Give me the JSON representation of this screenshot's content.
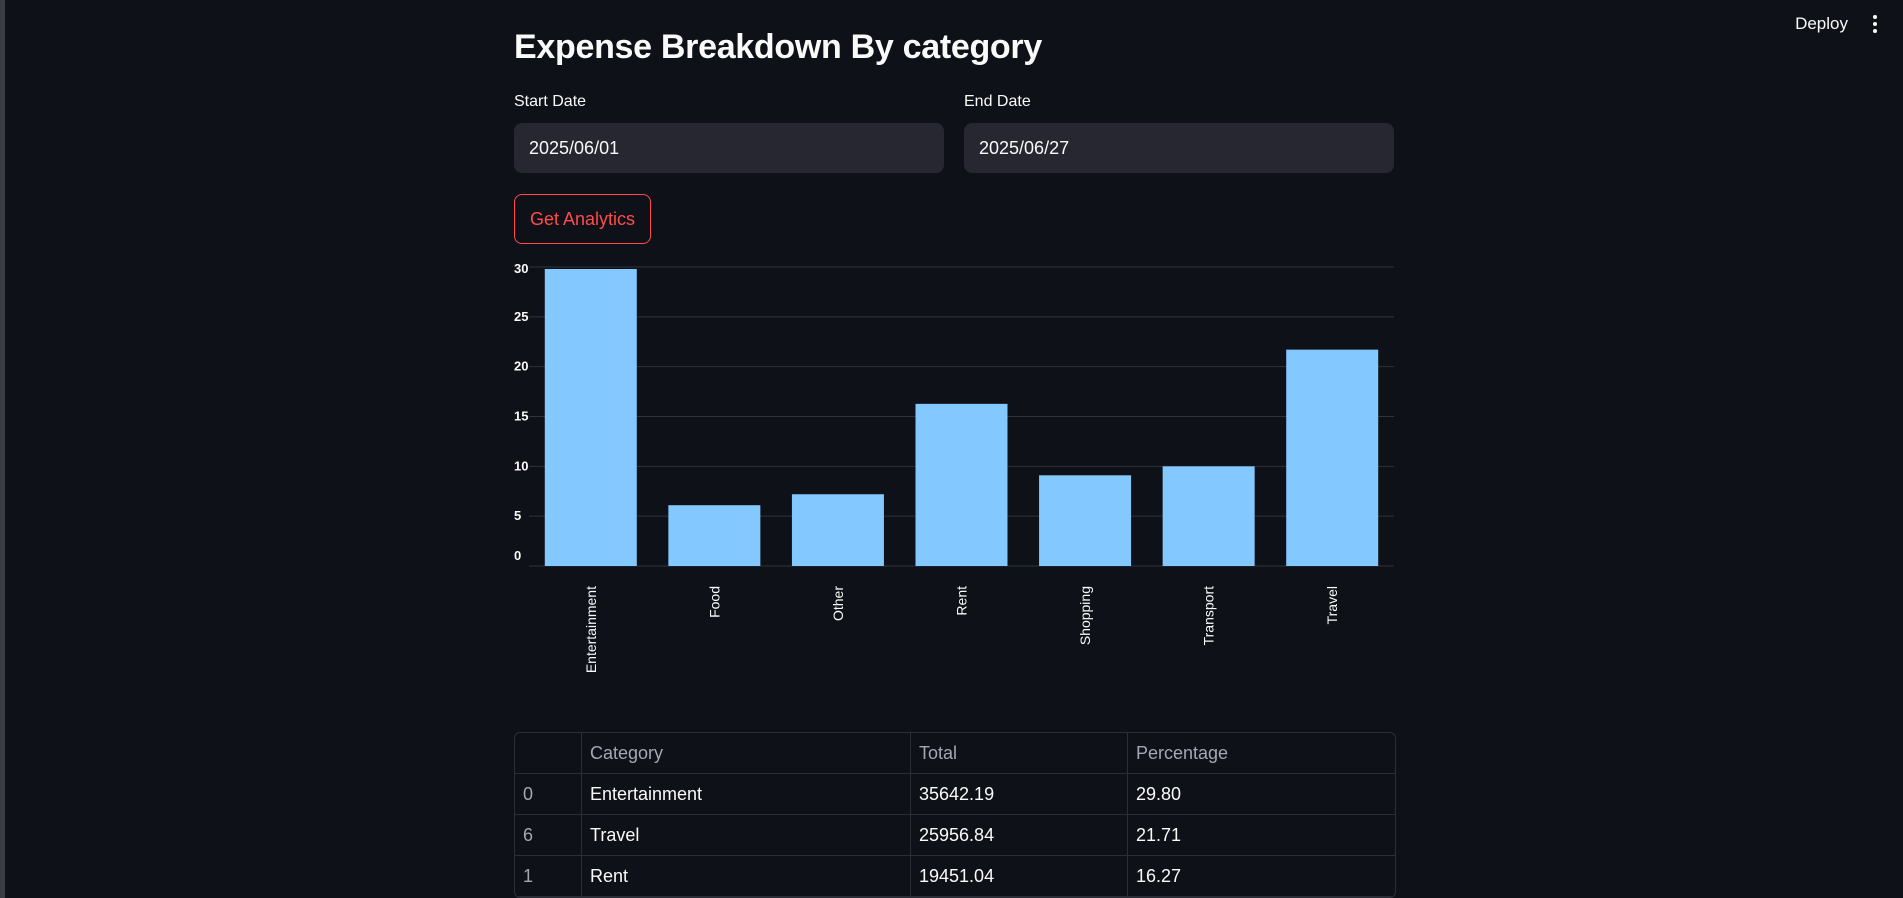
{
  "header": {
    "deploy_label": "Deploy",
    "menu_icon": "vertical-dots-icon"
  },
  "page": {
    "title": "Expense Breakdown By category"
  },
  "filters": {
    "start_label": "Start Date",
    "start_value": "2025/06/01",
    "end_label": "End Date",
    "end_value": "2025/06/27",
    "button_label": "Get Analytics"
  },
  "colors": {
    "bar": "#83c9ff",
    "accent": "#ff4b4b",
    "background": "#0e1117"
  },
  "chart_data": {
    "type": "bar",
    "categories": [
      "Entertainment",
      "Food",
      "Other",
      "Rent",
      "Shopping",
      "Transport",
      "Travel"
    ],
    "values": [
      29.8,
      6.1,
      7.2,
      16.27,
      9.1,
      10.0,
      21.71
    ],
    "ylim": [
      0,
      30
    ],
    "yticks": [
      0,
      5,
      10,
      15,
      20,
      25,
      30
    ],
    "grid": true,
    "title": "",
    "xlabel": "",
    "ylabel": ""
  },
  "table": {
    "columns": [
      "",
      "Category",
      "Total",
      "Percentage"
    ],
    "rows": [
      [
        "0",
        "Entertainment",
        "35642.19",
        "29.80"
      ],
      [
        "6",
        "Travel",
        "25956.84",
        "21.71"
      ],
      [
        "1",
        "Rent",
        "19451.04",
        "16.27"
      ]
    ]
  }
}
